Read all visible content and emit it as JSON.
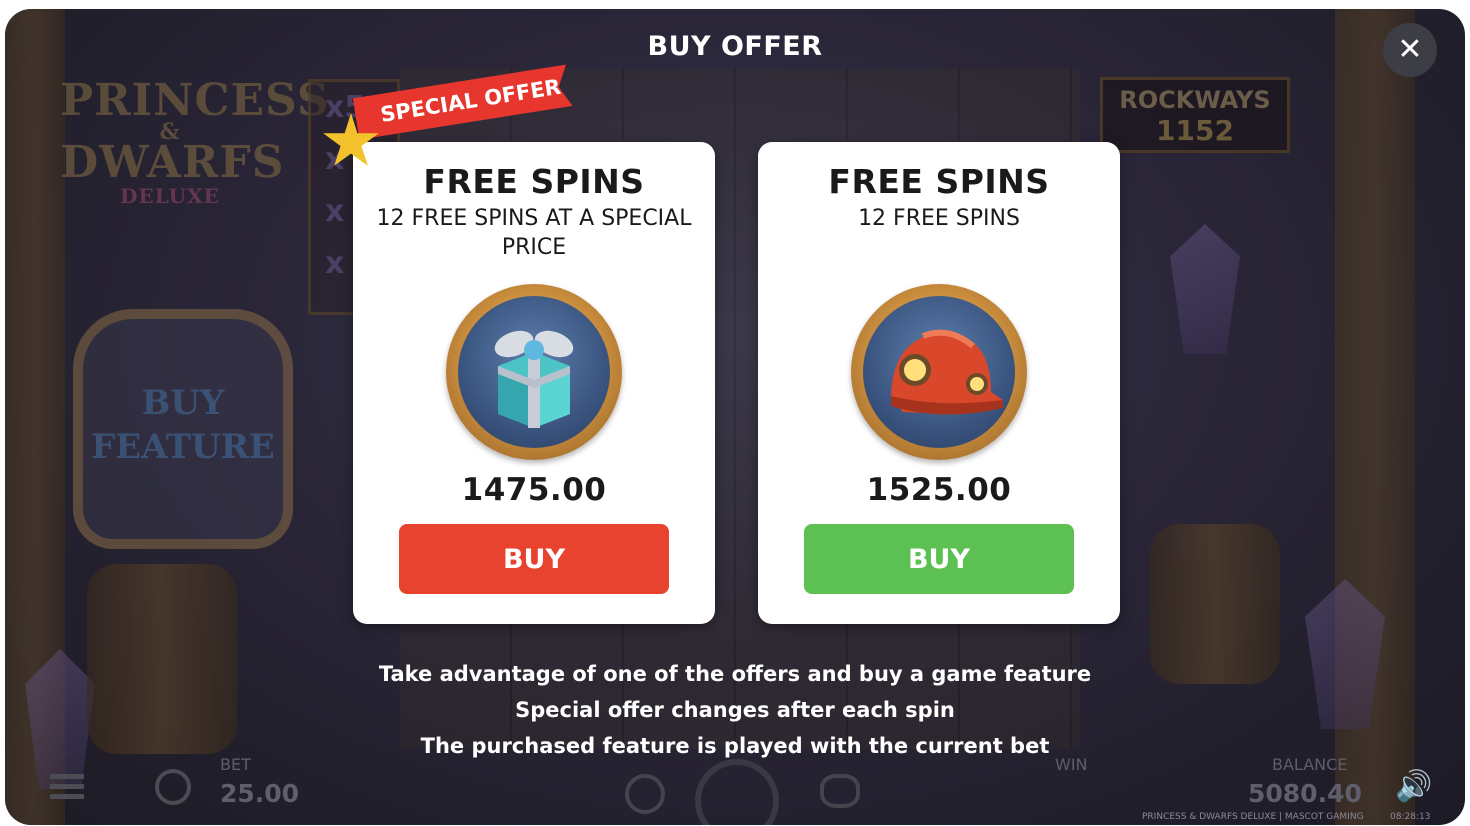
{
  "window": {
    "title": "BUY OFFER",
    "close_glyph": "✕"
  },
  "background": {
    "logo_line1": "PRINCESS",
    "logo_amp": "&",
    "logo_line2": "DWARFS",
    "logo_line3": "DELUXE",
    "buy_feature_line1": "BUY",
    "buy_feature_line2": "FEATURE",
    "multipliers": [
      "x5",
      "x",
      "x",
      "x"
    ],
    "rockways_label": "ROCKWAYS",
    "rockways_value": "1152"
  },
  "ribbon": {
    "label": "SPECIAL OFFER"
  },
  "offers": [
    {
      "title": "FREE SPINS",
      "subtitle": "12 FREE SPINS AT A SPECIAL PRICE",
      "icon": "gift-box-icon",
      "price": "1475.00",
      "button_label": "BUY",
      "button_color": "#e8432f"
    },
    {
      "title": "FREE SPINS",
      "subtitle": "12 FREE SPINS",
      "icon": "miner-helmet-icon",
      "price": "1525.00",
      "button_label": "BUY",
      "button_color": "#5cc152"
    }
  ],
  "info": [
    "Take advantage of one of the offers and buy a game feature",
    "Special offer changes after each spin",
    "The purchased feature is played with the current bet"
  ],
  "footer": {
    "bet_label": "BET",
    "bet_value": "25.00",
    "win_label": "WIN",
    "balance_label": "BALANCE",
    "balance_value": "5080.40",
    "game_credit": "PRINCESS & DWARFS DELUXE | MASCOT GAMING",
    "clock": "08:28:13"
  }
}
